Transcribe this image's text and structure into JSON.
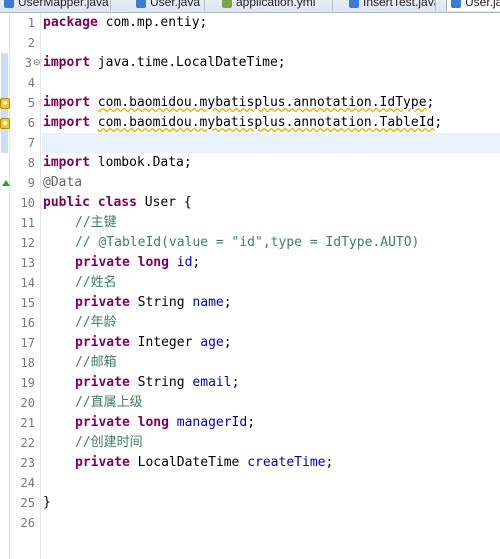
{
  "tabs": [
    {
      "label": "UserMapper.java",
      "icon": "java-file-icon"
    },
    {
      "label": "User.java",
      "icon": "java-file-icon"
    },
    {
      "label": "application.yml",
      "icon": "yml-file-icon"
    },
    {
      "label": "InsertTest.java",
      "icon": "java-file-icon"
    },
    {
      "label": "User.java",
      "icon": "java-file-icon",
      "active": true
    }
  ],
  "editor": {
    "line_numbers": [
      "1",
      "2",
      "3",
      "4",
      "5",
      "6",
      "7",
      "8",
      "9",
      "10",
      "11",
      "12",
      "13",
      "14",
      "15",
      "16",
      "17",
      "18",
      "19",
      "20",
      "21",
      "22",
      "23",
      "24",
      "25",
      "26"
    ],
    "fold_marker": "⊖",
    "tokens": {
      "l1_kw": "package",
      "l1_rest": " com.mp.entiy;",
      "l3_kw": "import",
      "l3_rest": " java.time.LocalDateTime;",
      "l5_kw": "import",
      "l5_rest": "com.baomidou.mybatisplus.annotation.IdType",
      "l5_end": ";",
      "l6_kw": "import",
      "l6_rest": "com.baomidou.mybatisplus.annotation.TableId",
      "l6_end": ";",
      "l8_kw": "import",
      "l8_rest": " lombok.Data;",
      "l9_ann": "@Data",
      "l10_kw1": "public",
      "l10_kw2": "class",
      "l10_rest": " User {",
      "l11_cm": "//主键",
      "l12_cm": "// @TableId(value = \"id\",type = IdType.AUTO)",
      "l13_kw1": "private",
      "l13_kw2": "long",
      "l13_fld": "id",
      "l13_end": ";",
      "l14_cm": "//姓名",
      "l15_kw": "private",
      "l15_type": " String ",
      "l15_fld": "name",
      "l15_end": ";",
      "l16_cm": "//年龄",
      "l17_kw": "private",
      "l17_type": " Integer ",
      "l17_fld": "age",
      "l17_end": ";",
      "l18_cm": "//邮箱",
      "l19_kw": "private",
      "l19_type": " String ",
      "l19_fld": "email",
      "l19_end": ";",
      "l20_cm": "//直属上级",
      "l21_kw1": "private",
      "l21_kw2": "long",
      "l21_fld": "managerId",
      "l21_end": ";",
      "l22_cm": "//创建时间",
      "l23_kw": "private",
      "l23_type": " LocalDateTime ",
      "l23_fld": "createTime",
      "l23_end": ";",
      "l25_brace": "}"
    }
  },
  "colors": {
    "keyword": "#7f0055",
    "comment": "#3f7f5f",
    "field": "#0000c0",
    "annotation": "#646464",
    "current_line": "#e8f2fe",
    "warning_underline": "#e3b000"
  }
}
